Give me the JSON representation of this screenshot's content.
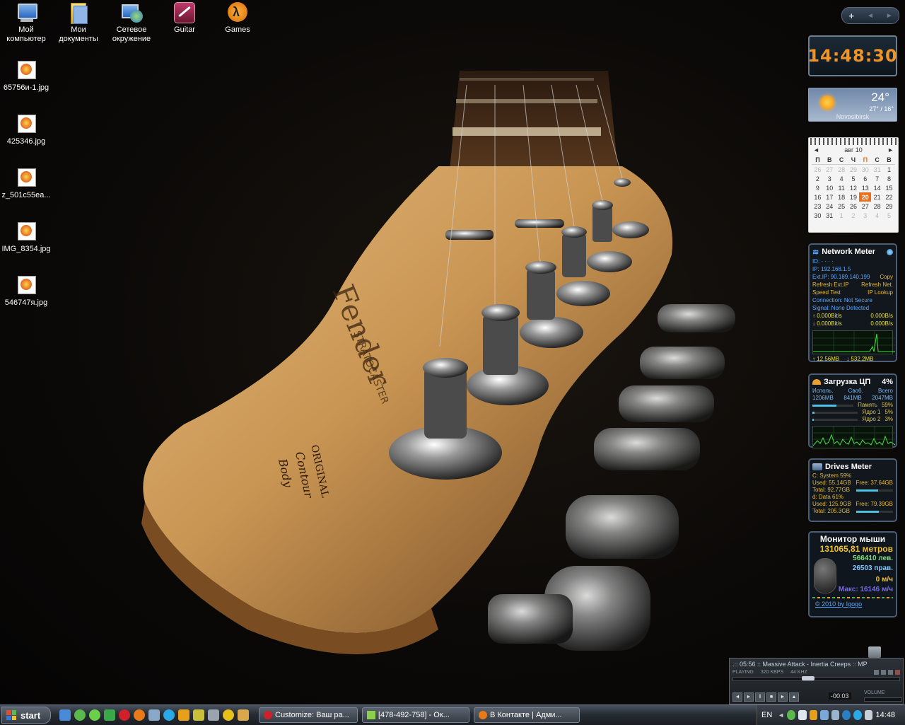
{
  "desktop": {
    "icons": [
      {
        "label": "Мой компьютер",
        "icon": "computer-icon"
      },
      {
        "label": "Мои документы",
        "icon": "documents-folder-icon"
      },
      {
        "label": "Сетевое окружение",
        "icon": "network-places-icon"
      },
      {
        "label": "Guitar",
        "icon": "guitar-app-icon"
      },
      {
        "label": "Games",
        "icon": "half-life-2-icon"
      },
      {
        "label": "65756и-1.jpg",
        "icon": "jpg-file-icon"
      },
      {
        "label": "425346.jpg",
        "icon": "jpg-file-icon"
      },
      {
        "label": "z_501c55ea...",
        "icon": "jpg-file-icon"
      },
      {
        "label": "IMG_8354.jpg",
        "icon": "jpg-file-icon"
      },
      {
        "label": "546747я.jpg",
        "icon": "jpg-file-icon"
      }
    ]
  },
  "sidebar": {
    "add_label": "+",
    "prev_label": "◄",
    "next_label": "►",
    "clock": {
      "time": "14:48:30"
    },
    "weather": {
      "temp": "24°",
      "range": "27° / 16°",
      "city": "Novosibirsk"
    },
    "calendar": {
      "month": "авг 10",
      "prev": "◄",
      "next": "►",
      "day_headers": [
        "П",
        "В",
        "С",
        "Ч",
        "П",
        "С",
        "В"
      ],
      "weeks": [
        [
          "26",
          "27",
          "28",
          "29",
          "30",
          "31",
          "1"
        ],
        [
          "2",
          "3",
          "4",
          "5",
          "6",
          "7",
          "8"
        ],
        [
          "9",
          "10",
          "11",
          "12",
          "13",
          "14",
          "15"
        ],
        [
          "16",
          "17",
          "18",
          "19",
          "20",
          "21",
          "22"
        ],
        [
          "23",
          "24",
          "25",
          "26",
          "27",
          "28",
          "29"
        ],
        [
          "30",
          "31",
          "1",
          "2",
          "3",
          "4",
          "5"
        ]
      ],
      "today": "20"
    },
    "network": {
      "title": "Network Meter",
      "id": "ID: · · · ·",
      "ip": "IP: 192.168.1.5",
      "ext_ip": "Ext.IP: 90.189.140.199",
      "copy": "Copy",
      "refresh_ext": "Refresh Ext.IP",
      "refresh_net": "Refresh Net.",
      "speed_test": "Speed Test",
      "ip_lookup": "IP Lookup",
      "connection": "Connection: Not Secure",
      "signal": "Signal: None Detected",
      "up_rate": "↑ 0.000Bit/s",
      "up_rate2": "0.000B/s",
      "down_rate": "↓ 0.000Bit/s",
      "down_rate2": "0.000B/s",
      "up_total": "↑ 12.56MB",
      "down_total": "↓ 532.2MB"
    },
    "cpu": {
      "title": "Загрузка ЦП",
      "percent": "4%",
      "h_used": "Исполь.",
      "h_free": "Своб.",
      "h_total": "Всего",
      "used": "1206MB",
      "free": "841MB",
      "total": "2047MB",
      "mem_label": "Память",
      "mem_pct": "59%",
      "mem_fill": 0.59,
      "core1_label": "Ядро 1",
      "core1_pct": "5%",
      "core1_fill": 0.05,
      "core2_label": "Ядро 2",
      "core2_pct": "3%",
      "core2_fill": 0.03
    },
    "drives": {
      "title": "Drives Meter",
      "c_name": "C:  System  59%",
      "c_used": "Used: 55.14GB",
      "c_free": "Free: 37.64GB",
      "c_total": "Total: 92.77GB",
      "c_fill": 0.59,
      "d_name": "d:  Data  61%",
      "d_used": "Used: 125.9GB",
      "d_free": "Free: 79.39GB",
      "d_total": "Total: 205.3GB",
      "d_fill": 0.61
    },
    "mouse": {
      "title": "Монитор мыши",
      "distance": "131065,81 метров",
      "left": "566410 лев.",
      "right": "26503 прав.",
      "speed": "0 м/ч",
      "max": "Макс: 16146 м/ч",
      "credit": "© 2010 by Igogo"
    }
  },
  "winamp": {
    "song": ".:: 05:56 :: Massive Attack - Inertia Creeps :: MP",
    "state": "PLAYING",
    "bitrate": "320 KBPS",
    "khz": "44 KHZ",
    "time": "-00:03",
    "volume_label": "VOLUME",
    "seek_pos": 0.45
  },
  "taskbar": {
    "start_label": "start",
    "tasks": [
      {
        "label": "Customize: Ваш ра...",
        "icon": "opera-icon"
      },
      {
        "label": "[478-492-758] - Ок...",
        "icon": "icq-window-icon"
      },
      {
        "label": "В Контакте | Адми...",
        "icon": "firefox-icon"
      }
    ],
    "lang": "EN",
    "clock": "14:48"
  },
  "colors": {
    "accent_orange": "#f09428",
    "gadget_border": "#4b5d74",
    "taskbar": "#262c33"
  }
}
